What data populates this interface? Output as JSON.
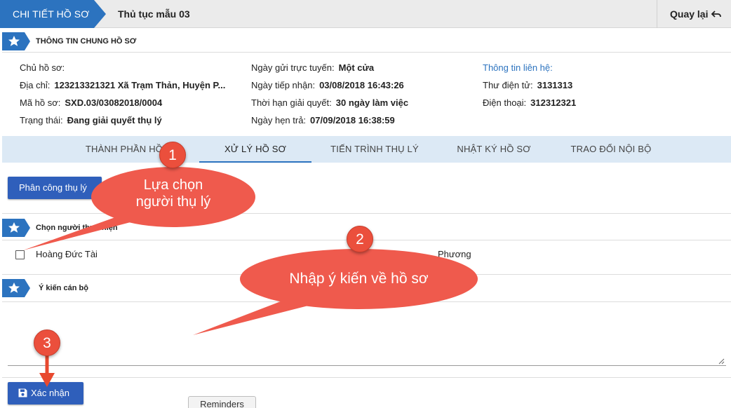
{
  "topbar": {
    "crumb_section": "CHI TIẾT HỒ SƠ",
    "crumb_title": "Thủ tục mẫu 03",
    "back_label": "Quay lại"
  },
  "general": {
    "title": "THÔNG TIN CHUNG HỒ SƠ",
    "owner_label": "Chủ hồ sơ:",
    "owner_value": "",
    "address_label": "Địa chỉ:",
    "address_value": "123213321321 Xã Trạm Thản, Huyện P...",
    "code_label": "Mã hồ sơ:",
    "code_value": "SXD.03/03082018/0004",
    "status_label": "Trạng thái:",
    "status_value": "Đang giải quyết thụ lý",
    "online_label": "Ngày gửi trực tuyến:",
    "online_value": "Một cửa",
    "received_label": "Ngày tiếp nhận:",
    "received_value": "03/08/2018 16:43:26",
    "deadline_label": "Thời hạn giải quyết:",
    "deadline_value": "30 ngày làm việc",
    "due_label": "Ngày hẹn trả:",
    "due_value": "07/09/2018 16:38:59",
    "contact_label": "Thông tin liên hệ:",
    "email_label": "Thư điện tử:",
    "email_value": "3131313",
    "phone_label": "Điện thoại:",
    "phone_value": "312312321"
  },
  "tabs": [
    {
      "label": "THÀNH PHẦN HỒ SƠ"
    },
    {
      "label": "XỬ LÝ HỒ SƠ"
    },
    {
      "label": "TIẾN TRÌNH THỤ LÝ"
    },
    {
      "label": "NHẬT KÝ HỒ SƠ"
    },
    {
      "label": "TRAO ĐỔI NỘI BỘ"
    }
  ],
  "processing": {
    "assign_button": "Phân công thụ lý",
    "chooser_title": "Chọn người thực hiện",
    "people": [
      "Hoàng Đức Tài",
      "Phương"
    ],
    "comment_title": "Ý kiến cán bộ",
    "confirm_button": "Xác nhận",
    "reminders_button": "Reminders"
  },
  "annotations": {
    "step1_number": "1",
    "step1_text_line1": "Lựa chọn",
    "step1_text_line2": "người thụ lý",
    "step2_number": "2",
    "step2_text": "Nhập ý kiến về hồ sơ",
    "step3_number": "3"
  },
  "colors": {
    "primary": "#2c73bf",
    "button_blue": "#2f5fbb",
    "tab_bg": "#dce9f5",
    "callout_red": "#ef5a4d"
  },
  "icons": {
    "section": "star-icon",
    "back": "undo-icon",
    "confirm": "save-icon"
  }
}
